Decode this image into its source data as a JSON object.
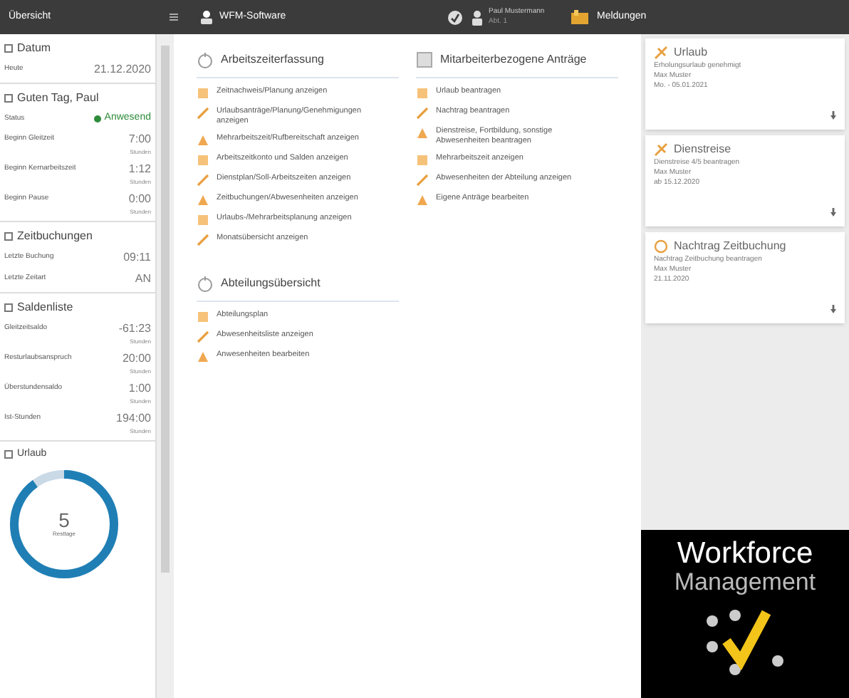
{
  "top_bar": {
    "left_title": "Übersicht",
    "app_title": "WFM-Software",
    "user_name": "Paul Mustermann",
    "user_sub": "Abt. 1",
    "messages_title": "Meldungen"
  },
  "left_panel": {
    "sections": [
      {
        "title": "Datum",
        "rows": [
          {
            "label": "Heute",
            "value": "21.12.2020"
          }
        ]
      },
      {
        "title": "Guten Tag, Paul",
        "rows": [
          {
            "label": "Status",
            "value": "Anwesend",
            "kind": "status",
            "color": "#2e8b3a"
          },
          {
            "label": "Beginn Gleitzeit",
            "value": "7:00",
            "unit": "Stunden"
          },
          {
            "label": "Beginn Kernarbeitszeit",
            "value": "1:12",
            "unit": "Stunden"
          },
          {
            "label": "Beginn Pause",
            "value": "0:00",
            "unit": "Stunden"
          }
        ]
      },
      {
        "title": "Zeitbuchungen",
        "rows": [
          {
            "label": "Letzte Buchung",
            "value": "09:11"
          },
          {
            "label": "Letzte Zeitart",
            "value": "AN"
          }
        ]
      },
      {
        "title": "Saldenliste",
        "rows": [
          {
            "label": "Gleitzeitsaldo",
            "value": "-61:23",
            "unit": "Stunden"
          },
          {
            "label": "Resturlaubsanspruch",
            "value": "20:00",
            "unit": "Stunden"
          },
          {
            "label": "Überstundensaldo",
            "value": "1:00",
            "unit": "Stunden"
          },
          {
            "label": "Ist-Stunden",
            "value": "194:00",
            "unit": "Stunden"
          }
        ]
      }
    ],
    "vacation": {
      "title": "Urlaub",
      "value": "5",
      "caption": "Resttage",
      "level": 0.9
    }
  },
  "main": {
    "columns": [
      [
        {
          "title": "Arbeitszeiterfassung",
          "items": [
            "Zeitnachweis/Planung anzeigen",
            "Urlaubsanträge/Planung/Genehmigungen anzeigen",
            "Mehrarbeitszeit/Rufbereitschaft anzeigen",
            "Arbeitszeitkonto und Salden anzeigen",
            "Dienstplan/Soll-Arbeitszeiten anzeigen",
            "Zeitbuchungen/Abwesenheiten anzeigen",
            "Urlaubs-/Mehrarbeitsplanung anzeigen",
            "Monatsübersicht anzeigen"
          ]
        },
        {
          "title": "Abteilungsübersicht",
          "items": [
            "Abteilungsplan",
            "Abwesenheitsliste anzeigen",
            "Anwesenheiten bearbeiten"
          ]
        }
      ],
      [
        {
          "title": "Mitarbeiterbezogene Anträge",
          "items": [
            "Urlaub beantragen",
            "Nachtrag beantragen",
            "Dienstreise, Fortbildung, sonstige Abwesenheiten beantragen",
            "Mehrarbeitszeit anzeigen",
            "Abwesenheiten der Abteilung anzeigen",
            "Eigene Anträge bearbeiten"
          ]
        }
      ]
    ]
  },
  "messages": [
    {
      "kind": "vacation",
      "title": "Urlaub",
      "lines": [
        "Erholungsurlaub genehmigt",
        "Max Muster",
        "Mo. - 05.01.2021"
      ]
    },
    {
      "kind": "trip",
      "title": "Dienstreise",
      "lines": [
        "Dienstreise 4/5 beantragen",
        "Max Muster",
        "ab 15.12.2020"
      ]
    },
    {
      "kind": "booking",
      "title": "Nachtrag Zeitbuchung",
      "lines": [
        "Nachtrag Zeitbuchung beantragen",
        "Max Muster",
        "21.11.2020"
      ]
    }
  ],
  "logo": {
    "line1": "Workforce",
    "line2": "Management"
  }
}
